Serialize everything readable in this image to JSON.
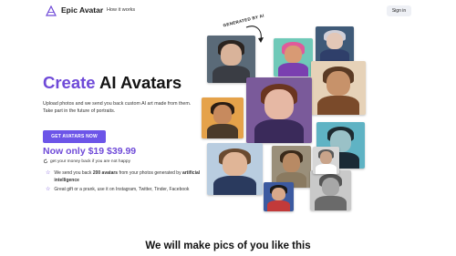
{
  "header": {
    "brand": "Epic Avatar",
    "nav_link": "How it works",
    "signin": "Sign in"
  },
  "hero": {
    "title_accent": "Create",
    "title_rest": " AI Avatars",
    "description": "Upload photos and we send you back custom AI art made from them. Take part in the future of portraits.",
    "cta": "GET AVATARS NOW",
    "price": "Now only $19 $39.99",
    "guarantee": "get your money back if you are not happy",
    "features": [
      {
        "pre": "We send you back ",
        "bold": "200 avatars",
        "mid": " from your photos generated by ",
        "bold2": "artificial intelligence"
      },
      {
        "text": "Great gift or a prank, use it on Instagram, Twitter, Tinder, Facebook"
      }
    ]
  },
  "gallery": {
    "annotation": "GENERATED BY AI",
    "tiles": [
      {
        "name": "portrait-woman-dark-hair",
        "bg": "#5a6a78",
        "skin": "#d9b39a",
        "hair": "#2b2420",
        "cloth": "#3a3d44"
      },
      {
        "name": "portrait-colorful-man",
        "bg": "#6fc9b8",
        "skin": "#d89a74",
        "hair": "#e05a9a",
        "cloth": "#7a3fb0"
      },
      {
        "name": "portrait-royal-old-woman",
        "bg": "#3f5a78",
        "skin": "#e3c7b7",
        "hair": "#cfcfd8",
        "cloth": "#2f3f6a"
      },
      {
        "name": "portrait-bearded-man",
        "bg": "#e6d2b8",
        "skin": "#c7926a",
        "hair": "#5a3a24",
        "cloth": "#7a4a2a"
      },
      {
        "name": "portrait-man-orange-bg",
        "bg": "#e5a24a",
        "skin": "#c78a5e",
        "hair": "#2a1d14",
        "cloth": "#4a3a2a"
      },
      {
        "name": "portrait-woman-fantasy",
        "bg": "#7a5a9a",
        "skin": "#e6b8a4",
        "hair": "#6a3520",
        "cloth": "#3a2a5a"
      },
      {
        "name": "portrait-sunglasses-man",
        "bg": "#5fb3c4",
        "skin": "#9ac1c7",
        "hair": "#1e2a30",
        "cloth": "#1a2a35"
      },
      {
        "name": "portrait-couple-photo",
        "bg": "#b9cde0",
        "skin": "#e0b597",
        "hair": "#6a4a30",
        "cloth": "#2a3a5e"
      },
      {
        "name": "portrait-muscular-man",
        "bg": "#9a8f7a",
        "skin": "#b88a64",
        "hair": "#3a2a1a",
        "cloth": "#8a7a60"
      },
      {
        "name": "portrait-superhero",
        "bg": "#3c5aa0",
        "skin": "#d7a88a",
        "hair": "#1a1a1a",
        "cloth": "#c23a3a"
      },
      {
        "name": "portrait-armored-figure",
        "bg": "#c9c9c9",
        "skin": "#a7a7a7",
        "hair": "#555555",
        "cloth": "#6a6a6a"
      },
      {
        "name": "portrait-man-smile",
        "bg": "#d7d7d7",
        "skin": "#c9a48a",
        "hair": "#5a5a5a",
        "cloth": "#ffffff"
      }
    ]
  },
  "section": {
    "heading": "We will make pics of you like this"
  },
  "colors": {
    "accent": "#6f4ad8",
    "button": "#6c55e8",
    "signin_bg": "#eef0f5"
  }
}
